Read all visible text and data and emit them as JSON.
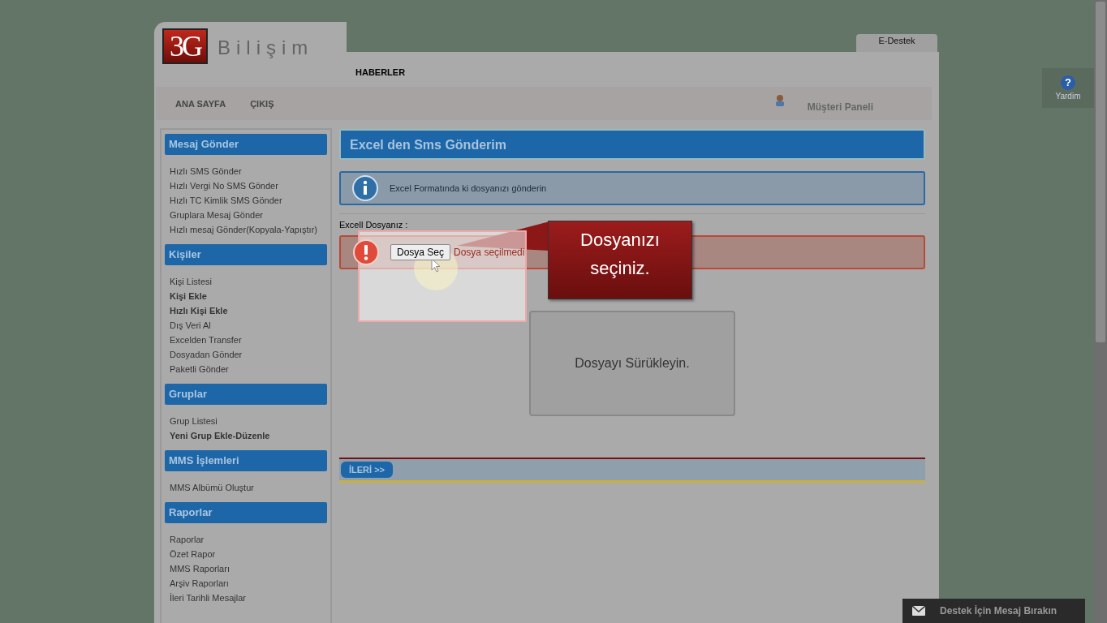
{
  "header": {
    "logo_text": "3G",
    "brand": "Bilişim",
    "tabs": [
      {
        "label": "HABERLER",
        "selected": true
      }
    ],
    "support_tab": "E-Destek"
  },
  "nav": {
    "links": [
      "ANA SAYFA",
      "ÇIKIŞ"
    ],
    "panel_link": "Müşteri Paneli"
  },
  "sidebar": {
    "sections": [
      {
        "title": "Mesaj Gönder",
        "items": [
          {
            "label": "Hızlı SMS Gönder",
            "emphasized": false
          },
          {
            "label": "Hızlı Vergi No SMS Gönder",
            "emphasized": false
          },
          {
            "label": "Hızlı TC Kimlik SMS Gönder",
            "emphasized": false
          },
          {
            "label": "Gruplara Mesaj Gönder",
            "emphasized": false
          },
          {
            "label": "Hızlı mesaj Gönder(Kopyala-Yapıştır)",
            "emphasized": false
          }
        ]
      },
      {
        "title": "Kişiler",
        "items": [
          {
            "label": "Kişi Listesi",
            "emphasized": false
          },
          {
            "label": "Kişi Ekle",
            "emphasized": true
          },
          {
            "label": "Hızlı Kişi Ekle",
            "emphasized": true
          },
          {
            "label": "Dış Veri Al",
            "emphasized": false
          },
          {
            "label": "Excelden Transfer",
            "emphasized": false
          },
          {
            "label": "Dosyadan Gönder",
            "emphasized": false
          },
          {
            "label": "Paketli Gönder",
            "emphasized": false
          }
        ]
      },
      {
        "title": "Gruplar",
        "items": [
          {
            "label": "Grup Listesi",
            "emphasized": false
          },
          {
            "label": "Yeni Grup Ekle-Düzenle",
            "emphasized": true
          }
        ]
      },
      {
        "title": "MMS İşlemleri",
        "items": [
          {
            "label": "MMS Albümü Oluştur",
            "emphasized": false
          }
        ]
      },
      {
        "title": "Raporlar",
        "items": [
          {
            "label": "Raporlar",
            "emphasized": false
          },
          {
            "label": "Özet Rapor",
            "emphasized": false
          },
          {
            "label": "MMS Raporları",
            "emphasized": false
          },
          {
            "label": "Arşiv Raporları",
            "emphasized": false
          },
          {
            "label": "İleri Tarihli Mesajlar",
            "emphasized": false
          }
        ]
      }
    ]
  },
  "content": {
    "title": "Excel den Sms Gönderim",
    "info": "Excel Formatında ki dosyanızı gönderin",
    "file_label": "Excell Dosyanız :",
    "file_button": "Dosya Seç",
    "file_status": "Dosya seçilmedi",
    "drop_zone": "Dosyayı Sürükleyin.",
    "next_button": "İLERİ >>"
  },
  "callout": "Dosyanızı seçiniz.",
  "help": {
    "icon": "?",
    "label": "Yardim"
  },
  "chat_bar": {
    "label": "Destek İçin Mesaj Bırakın"
  }
}
